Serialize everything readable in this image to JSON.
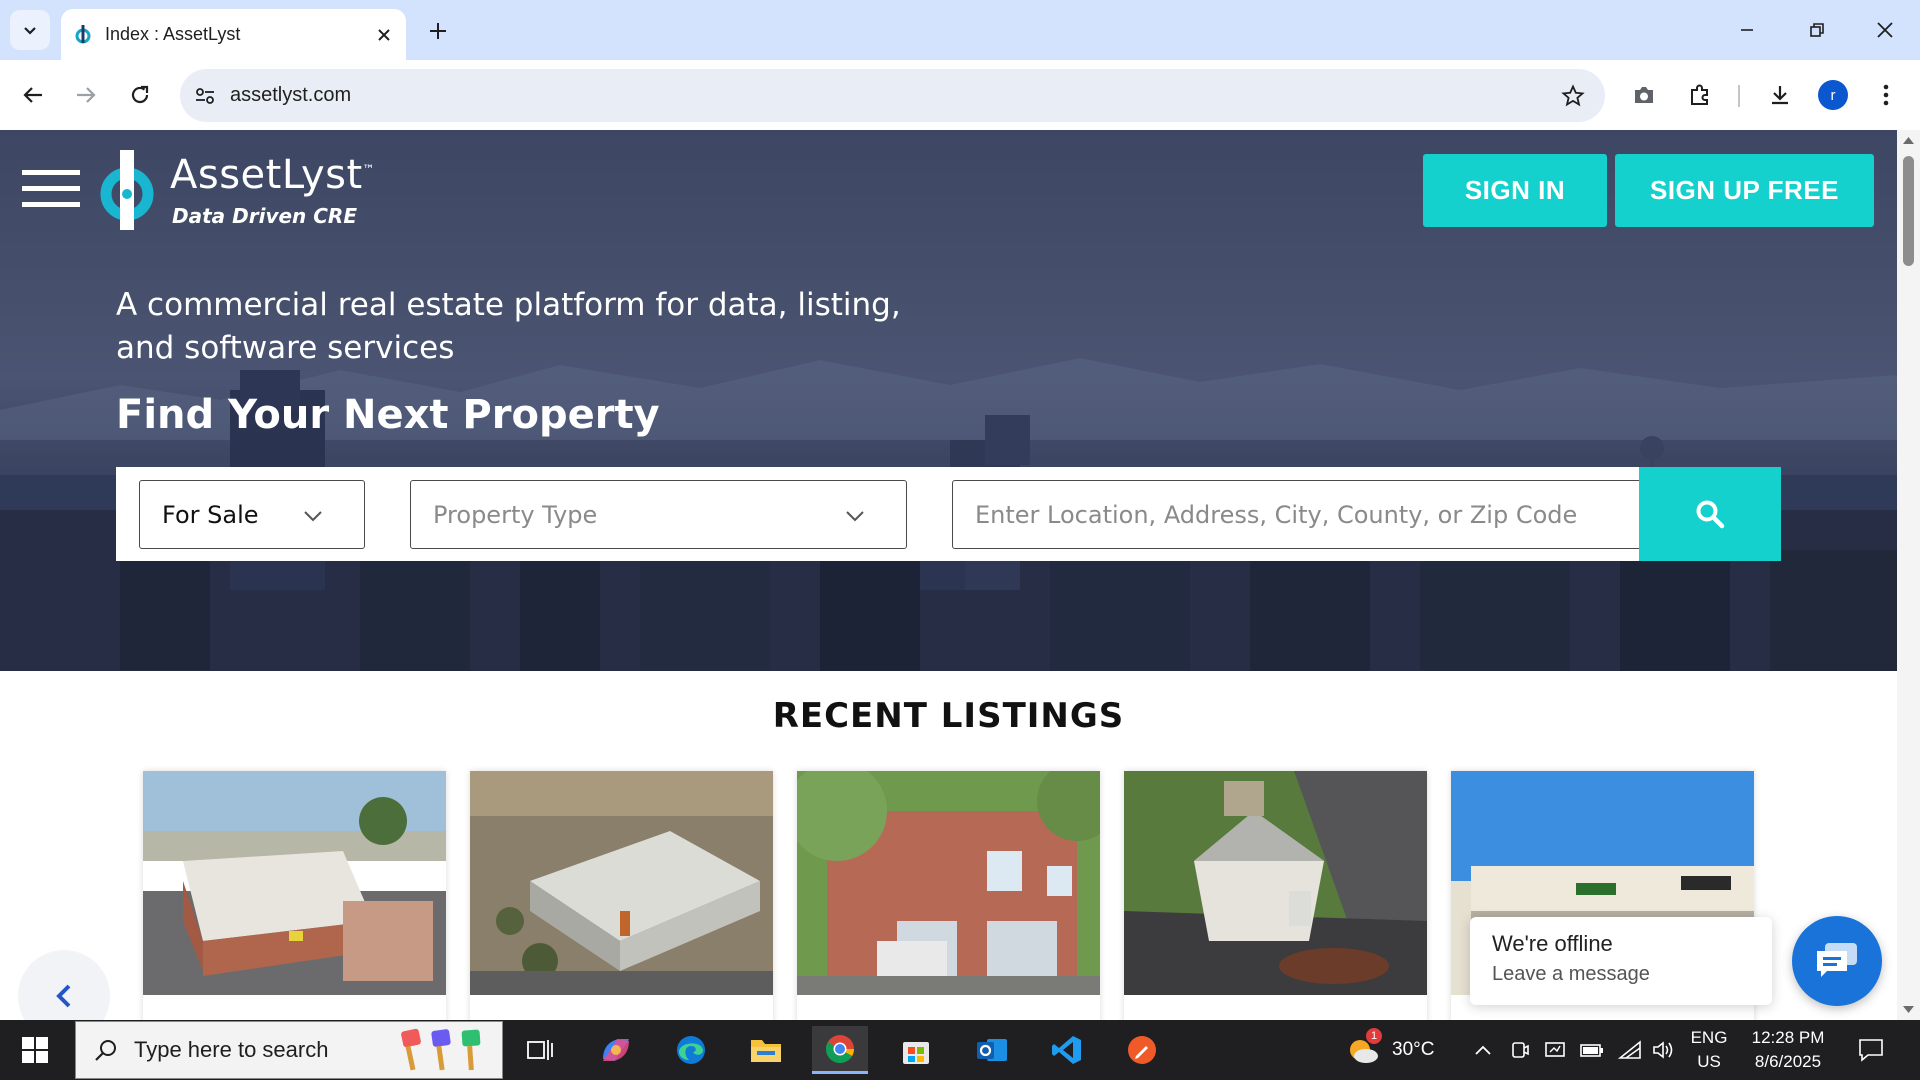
{
  "browser": {
    "tab_title": "Index : AssetLyst",
    "url": "assetlyst.com",
    "profile_initial": "r"
  },
  "site": {
    "logo_name": "AssetLyst",
    "logo_tm": "™",
    "logo_tagline": "Data Driven CRE",
    "sign_in": "SIGN IN",
    "sign_up": "SIGN UP FREE",
    "tagline": "A commercial real estate platform for data, listing, and software services",
    "heading": "Find Your Next Property",
    "search": {
      "listing_type": "For Sale",
      "property_type_placeholder": "Property Type",
      "location_placeholder": "Enter Location, Address, City, County, or Zip Code"
    },
    "recent_listings_title": "RECENT LISTINGS",
    "chat": {
      "status": "We're offline",
      "sub": "Leave a message"
    }
  },
  "taskbar": {
    "search_placeholder": "Type here to search",
    "weather_temp": "30°C",
    "weather_badge": "1",
    "lang_top": "ENG",
    "lang_bottom": "US",
    "time": "12:28 PM",
    "date": "8/6/2025"
  },
  "colors": {
    "accent": "#14d1cd",
    "chat_blue": "#1a73d9",
    "hero_overlay": "#3d4763"
  }
}
